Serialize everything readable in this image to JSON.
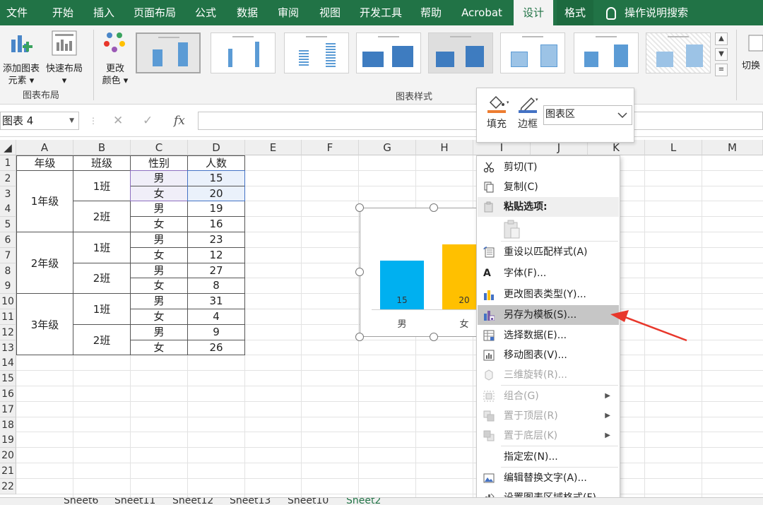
{
  "ribbon_tabs": [
    "文件",
    "开始",
    "插入",
    "页面布局",
    "公式",
    "数据",
    "审阅",
    "视图",
    "开发工具",
    "帮助",
    "Acrobat",
    "设计",
    "格式"
  ],
  "active_tab": "设计",
  "tell_me": "操作说明搜索",
  "ribbon": {
    "add_element": "添加图表\n元素",
    "add_element_line1": "添加图表",
    "add_element_line2": "元素 ▾",
    "quick_layout": "快速布局",
    "quick_layout_dd": "▾",
    "change_colors_line1": "更改",
    "change_colors_line2": "颜色 ▾",
    "group_chart_layout": "图表布局",
    "group_chart_styles": "图表样式",
    "switch_label": "切换"
  },
  "formula_bar": {
    "name_box": "图表 4",
    "fx": "fx",
    "cancel": "✕",
    "confirm": "✓"
  },
  "columns": [
    "A",
    "B",
    "C",
    "D",
    "E",
    "F",
    "G",
    "H",
    "I",
    "J",
    "K",
    "L",
    "M"
  ],
  "rows": [
    "1",
    "2",
    "3",
    "4",
    "5",
    "6",
    "7",
    "8",
    "9",
    "10",
    "11",
    "12",
    "13",
    "14",
    "15",
    "16",
    "17",
    "18",
    "19",
    "20",
    "21",
    "22"
  ],
  "table": {
    "headers": [
      "年级",
      "班级",
      "性别",
      "人数"
    ],
    "grades": [
      "1年级",
      "2年级",
      "3年级"
    ],
    "classes": [
      "1班",
      "2班",
      "1班",
      "2班",
      "1班",
      "2班"
    ],
    "genders": [
      "男",
      "女",
      "男",
      "女",
      "男",
      "女",
      "男",
      "女",
      "男",
      "女",
      "男",
      "女"
    ],
    "counts": [
      "15",
      "20",
      "19",
      "16",
      "23",
      "12",
      "27",
      "8",
      "31",
      "4",
      "9",
      "26"
    ]
  },
  "chart_data": {
    "type": "bar",
    "categories": [
      "男",
      "女"
    ],
    "values": [
      15,
      20
    ],
    "colors": [
      "#00b0f0",
      "#ffc000"
    ],
    "title": ""
  },
  "mini_toolbar": {
    "fill": "填充",
    "border": "边框",
    "element_select": "图表区"
  },
  "context_menu": {
    "items": [
      {
        "label": "剪切(T)",
        "icon": "scissors-icon",
        "disabled": false
      },
      {
        "label": "复制(C)",
        "icon": "copy-icon",
        "disabled": false
      },
      {
        "label": "粘贴选项:",
        "icon": "paste-icon",
        "disabled": true
      },
      {
        "label": "重设以匹配样式(A)",
        "icon": "reset-style-icon",
        "disabled": false
      },
      {
        "label": "字体(F)...",
        "icon": "font-icon",
        "disabled": false
      },
      {
        "label": "更改图表类型(Y)...",
        "icon": "chart-type-icon",
        "disabled": false
      },
      {
        "label": "另存为模板(S)...",
        "icon": "save-template-icon",
        "disabled": false
      },
      {
        "label": "选择数据(E)...",
        "icon": "select-data-icon",
        "disabled": false
      },
      {
        "label": "移动图表(V)...",
        "icon": "move-chart-icon",
        "disabled": false
      },
      {
        "label": "三维旋转(R)...",
        "icon": "3d-rotate-icon",
        "disabled": true
      },
      {
        "label": "组合(G)",
        "icon": "group-icon",
        "disabled": true
      },
      {
        "label": "置于顶层(R)",
        "icon": "bring-front-icon",
        "disabled": true
      },
      {
        "label": "置于底层(K)",
        "icon": "send-back-icon",
        "disabled": true
      },
      {
        "label": "指定宏(N)...",
        "icon": "",
        "disabled": false
      },
      {
        "label": "编辑替换文字(A)...",
        "icon": "alt-text-icon",
        "disabled": false
      },
      {
        "label": "设置图表区域格式(F)...",
        "icon": "format-area-icon",
        "disabled": false
      }
    ]
  },
  "sheet_tabs": [
    "Sheet6",
    "Sheet11",
    "Sheet12",
    "Sheet13",
    "Sheet10",
    "Sheet2"
  ],
  "active_sheet": "Sheet2",
  "colors": {
    "excel_green": "#217346",
    "highlight_arrow": "#e8372b"
  }
}
